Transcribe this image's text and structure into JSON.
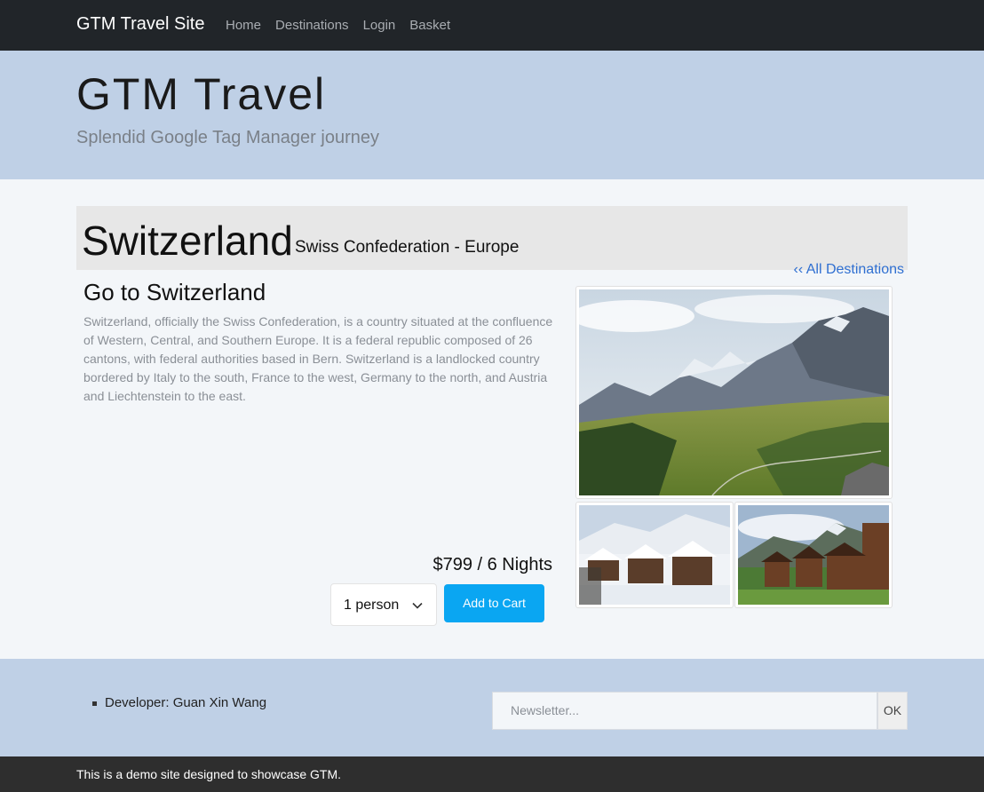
{
  "navbar": {
    "brand": "GTM Travel Site",
    "links": [
      "Home",
      "Destinations",
      "Login",
      "Basket"
    ]
  },
  "hero": {
    "title": "GTM Travel",
    "subtitle": "Splendid Google Tag Manager journey"
  },
  "destination": {
    "name": "Switzerland",
    "region": "Swiss Confederation - Europe",
    "back_link": "‹‹ All Destinations",
    "heading": "Go to Switzerland",
    "description": "Switzerland, officially the Swiss Confederation, is a country situated at the confluence of Western, Central, and Southern Europe. It is a federal republic composed of 26 cantons, with federal authorities based in Bern. Switzerland is a landlocked country bordered by Italy to the south, France to the west, Germany to the north, and Austria and Liechtenstein to the east.",
    "price": "$799 / 6 Nights",
    "persons_selected": "1 person",
    "add_to_cart": "Add to Cart"
  },
  "footer": {
    "developer": "Developer: Guan Xin Wang",
    "newsletter_placeholder": "Newsletter...",
    "ok": "OK",
    "bottom_text": "This is a demo site designed to showcase GTM."
  },
  "colors": {
    "navbar": "#212529",
    "hero": "#bfd0e6",
    "accent_button": "#0aa6f2",
    "link": "#2f6fd1"
  }
}
